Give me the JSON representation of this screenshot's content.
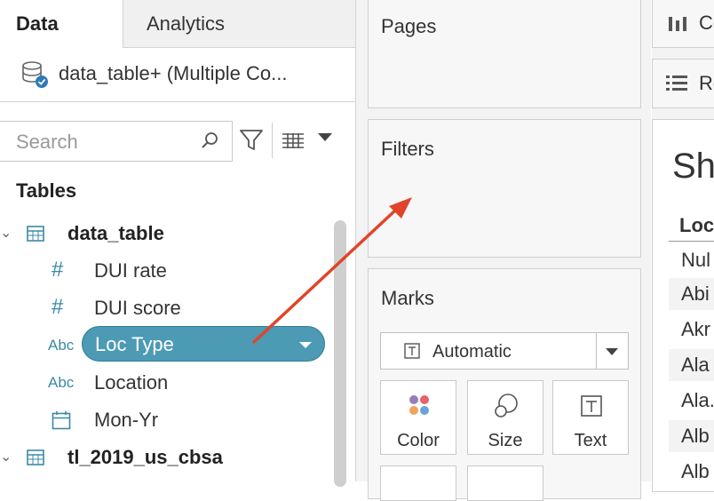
{
  "tabs": {
    "data": "Data",
    "analytics": "Analytics"
  },
  "datasource": {
    "name": "data_table+ (Multiple Co..."
  },
  "search": {
    "placeholder": "Search"
  },
  "tables_heading": "Tables",
  "tables": [
    {
      "name": "data_table",
      "fields": [
        {
          "type": "#",
          "name": "DUI rate"
        },
        {
          "type": "#",
          "name": "DUI score"
        },
        {
          "type": "Abc",
          "name": "Loc Type",
          "selected": true
        },
        {
          "type": "Abc",
          "name": "Location"
        },
        {
          "type": "date",
          "name": "Mon-Yr"
        }
      ]
    },
    {
      "name": "tl_2019_us_cbsa"
    }
  ],
  "shelves": {
    "pages": "Pages",
    "filters": "Filters",
    "marks": "Marks",
    "columns": "Co",
    "rows": "Ro"
  },
  "marks": {
    "type": "Automatic",
    "buttons": [
      "Color",
      "Size",
      "Text"
    ]
  },
  "sheet": {
    "title": "Sh",
    "column_header": "Loc",
    "rows": [
      "Nul",
      "Abi",
      "Akr",
      "Ala",
      "Ala.",
      "Alb",
      "Alb"
    ]
  },
  "colors": {
    "accent": "#4d9ab4",
    "arrow": "#e0452b",
    "field_type": "#3a8aa6"
  },
  "annotation": {
    "type": "arrow",
    "from": "Loc Type field",
    "to": "Filters shelf"
  }
}
